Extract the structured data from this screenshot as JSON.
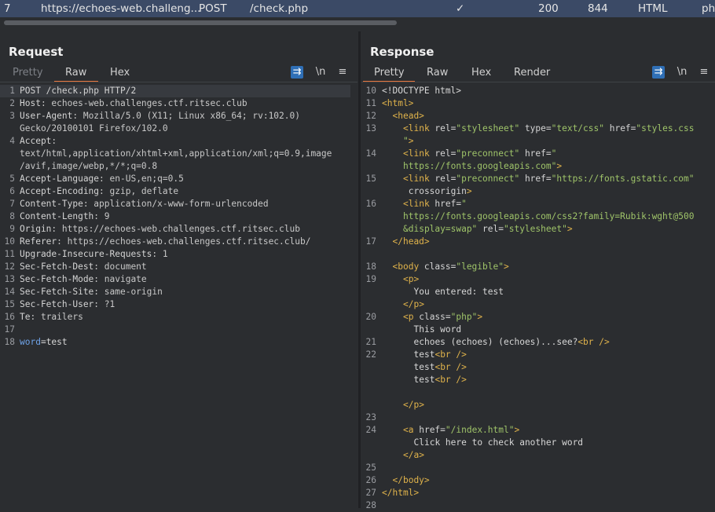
{
  "top_row": {
    "index": "7",
    "host": "https://echoes-web.challeng...",
    "method": "POST",
    "url": "/check.php",
    "check": "✓",
    "status": "200",
    "length": "844",
    "mime": "HTML",
    "ext": "ph"
  },
  "request": {
    "title": "Request",
    "tabs": [
      "Pretty",
      "Raw",
      "Hex"
    ],
    "toolbar": {
      "wrap": "⇉",
      "newline": "\\n",
      "menu": "≡"
    },
    "lines": [
      {
        "n": "1",
        "k": "POST /check.php HTTP/2",
        "v": ""
      },
      {
        "n": "2",
        "k": "Host",
        "v": ": echoes-web.challenges.ctf.ritsec.club"
      },
      {
        "n": "3",
        "k": "User-Agent",
        "v": ": Mozilla/5.0 (X11; Linux x86_64; rv:102.0)"
      },
      {
        "n": "",
        "k": "",
        "v": "Gecko/20100101 Firefox/102.0"
      },
      {
        "n": "4",
        "k": "Accept",
        "v": ":"
      },
      {
        "n": "",
        "k": "",
        "v": "text/html,application/xhtml+xml,application/xml;q=0.9,image"
      },
      {
        "n": "",
        "k": "",
        "v": "/avif,image/webp,*/*;q=0.8"
      },
      {
        "n": "5",
        "k": "Accept-Language",
        "v": ": en-US,en;q=0.5"
      },
      {
        "n": "6",
        "k": "Accept-Encoding",
        "v": ": gzip, deflate"
      },
      {
        "n": "7",
        "k": "Content-Type",
        "v": ": application/x-www-form-urlencoded"
      },
      {
        "n": "8",
        "k": "Content-Length",
        "v": ": 9"
      },
      {
        "n": "9",
        "k": "Origin",
        "v": ": https://echoes-web.challenges.ctf.ritsec.club"
      },
      {
        "n": "10",
        "k": "Referer",
        "v": ": https://echoes-web.challenges.ctf.ritsec.club/"
      },
      {
        "n": "11",
        "k": "Upgrade-Insecure-Requests",
        "v": ": 1"
      },
      {
        "n": "12",
        "k": "Sec-Fetch-Dest",
        "v": ": document"
      },
      {
        "n": "13",
        "k": "Sec-Fetch-Mode",
        "v": ": navigate"
      },
      {
        "n": "14",
        "k": "Sec-Fetch-Site",
        "v": ": same-origin"
      },
      {
        "n": "15",
        "k": "Sec-Fetch-User",
        "v": ": ?1"
      },
      {
        "n": "16",
        "k": "Te",
        "v": ": trailers"
      },
      {
        "n": "17",
        "k": "",
        "v": ""
      },
      {
        "n": "18",
        "k": "word",
        "v": "=test"
      }
    ]
  },
  "response": {
    "title": "Response",
    "tabs": [
      "Pretty",
      "Raw",
      "Hex",
      "Render"
    ],
    "toolbar": {
      "wrap": "⇉",
      "newline": "\\n",
      "menu": "≡"
    },
    "lines": [
      {
        "n": "10",
        "i": 0,
        "segs": [
          [
            "txt",
            "<!DOCTYPE html>"
          ]
        ]
      },
      {
        "n": "11",
        "i": 0,
        "segs": [
          [
            "tag",
            "<html>"
          ]
        ]
      },
      {
        "n": "12",
        "i": 1,
        "segs": [
          [
            "tag",
            "<head>"
          ]
        ]
      },
      {
        "n": "13",
        "i": 2,
        "segs": [
          [
            "tag",
            "<link "
          ],
          [
            "att",
            "rel="
          ],
          [
            "str",
            "\"stylesheet\""
          ],
          [
            "att",
            " type="
          ],
          [
            "str",
            "\"text/css\""
          ],
          [
            "att",
            " href="
          ],
          [
            "str",
            "\"styles.css"
          ]
        ]
      },
      {
        "n": "",
        "i": 2,
        "segs": [
          [
            "str",
            "\""
          ],
          [
            "tag",
            ">"
          ]
        ]
      },
      {
        "n": "14",
        "i": 2,
        "segs": [
          [
            "tag",
            "<link "
          ],
          [
            "att",
            "rel="
          ],
          [
            "str",
            "\"preconnect\""
          ],
          [
            "att",
            " href="
          ],
          [
            "str",
            "\""
          ]
        ]
      },
      {
        "n": "",
        "i": 2,
        "segs": [
          [
            "str",
            "https://fonts.googleapis.com\""
          ],
          [
            "tag",
            ">"
          ]
        ]
      },
      {
        "n": "15",
        "i": 2,
        "segs": [
          [
            "tag",
            "<link "
          ],
          [
            "att",
            "rel="
          ],
          [
            "str",
            "\"preconnect\""
          ],
          [
            "att",
            " href="
          ],
          [
            "str",
            "\"https://fonts.gstatic.com\""
          ]
        ]
      },
      {
        "n": "",
        "i": 2,
        "segs": [
          [
            "att",
            " crossorigin"
          ],
          [
            "tag",
            ">"
          ]
        ]
      },
      {
        "n": "16",
        "i": 2,
        "segs": [
          [
            "tag",
            "<link "
          ],
          [
            "att",
            "href="
          ],
          [
            "str",
            "\""
          ]
        ]
      },
      {
        "n": "",
        "i": 2,
        "segs": [
          [
            "str",
            "https://fonts.googleapis.com/css2?family=Rubik:wght@500"
          ]
        ]
      },
      {
        "n": "",
        "i": 2,
        "segs": [
          [
            "str",
            "&display=swap\""
          ],
          [
            "att",
            " rel="
          ],
          [
            "str",
            "\"stylesheet\""
          ],
          [
            "tag",
            ">"
          ]
        ]
      },
      {
        "n": "17",
        "i": 1,
        "segs": [
          [
            "tag",
            "</head>"
          ]
        ]
      },
      {
        "n": "",
        "i": 0,
        "segs": []
      },
      {
        "n": "18",
        "i": 1,
        "segs": [
          [
            "tag",
            "<body "
          ],
          [
            "att",
            "class="
          ],
          [
            "str",
            "\"legible\""
          ],
          [
            "tag",
            ">"
          ]
        ]
      },
      {
        "n": "19",
        "i": 2,
        "segs": [
          [
            "tag",
            "<p>"
          ]
        ]
      },
      {
        "n": "",
        "i": 3,
        "segs": [
          [
            "txt",
            "You entered: test"
          ]
        ]
      },
      {
        "n": "",
        "i": 2,
        "segs": [
          [
            "tag",
            "</p>"
          ]
        ]
      },
      {
        "n": "20",
        "i": 2,
        "segs": [
          [
            "tag",
            "<p "
          ],
          [
            "att",
            "class="
          ],
          [
            "str",
            "\"php\""
          ],
          [
            "tag",
            ">"
          ]
        ]
      },
      {
        "n": "",
        "i": 3,
        "segs": [
          [
            "txt",
            "This word"
          ]
        ]
      },
      {
        "n": "21",
        "i": 3,
        "segs": [
          [
            "txt",
            "echoes (echoes) (echoes)...see?"
          ],
          [
            "tag",
            "<br />"
          ]
        ]
      },
      {
        "n": "22",
        "i": 3,
        "segs": [
          [
            "txt",
            "test"
          ],
          [
            "tag",
            "<br />"
          ]
        ]
      },
      {
        "n": "",
        "i": 3,
        "segs": [
          [
            "txt",
            "test"
          ],
          [
            "tag",
            "<br />"
          ]
        ]
      },
      {
        "n": "",
        "i": 3,
        "segs": [
          [
            "txt",
            "test"
          ],
          [
            "tag",
            "<br />"
          ]
        ]
      },
      {
        "n": "",
        "i": 0,
        "segs": []
      },
      {
        "n": "",
        "i": 2,
        "segs": [
          [
            "tag",
            "</p>"
          ]
        ]
      },
      {
        "n": "23",
        "i": 0,
        "segs": []
      },
      {
        "n": "24",
        "i": 2,
        "segs": [
          [
            "tag",
            "<a "
          ],
          [
            "att",
            "href="
          ],
          [
            "str",
            "\"/index.html\""
          ],
          [
            "tag",
            ">"
          ]
        ]
      },
      {
        "n": "",
        "i": 3,
        "segs": [
          [
            "txt",
            "Click here to check another word"
          ]
        ]
      },
      {
        "n": "",
        "i": 2,
        "segs": [
          [
            "tag",
            "</a>"
          ]
        ]
      },
      {
        "n": "25",
        "i": 0,
        "segs": []
      },
      {
        "n": "26",
        "i": 1,
        "segs": [
          [
            "tag",
            "</body>"
          ]
        ]
      },
      {
        "n": "27",
        "i": 0,
        "segs": [
          [
            "tag",
            "</html>"
          ]
        ]
      },
      {
        "n": "28",
        "i": 0,
        "segs": []
      }
    ]
  },
  "colors": {
    "accent_tab": "#e8763c",
    "active_button": "#2f6fb6",
    "selected_row": "#3b4a66"
  }
}
